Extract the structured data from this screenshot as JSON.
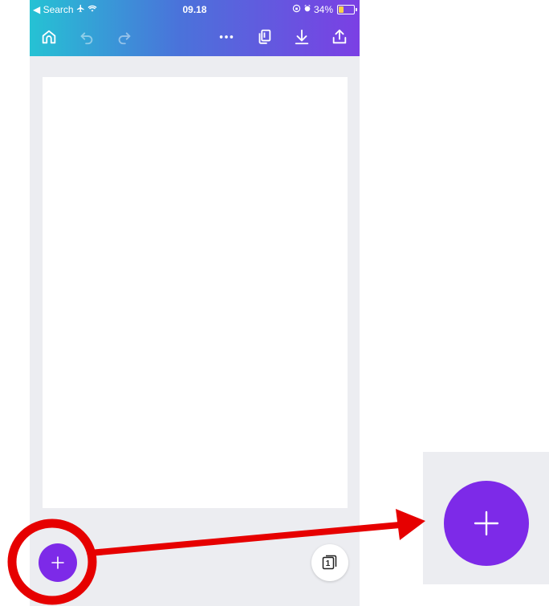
{
  "status_bar": {
    "back_label": "◀ Search",
    "time": "09.18",
    "battery": "34%",
    "battery_level": 0.34
  },
  "toolbar": {
    "icons": [
      "home-icon",
      "undo-icon",
      "redo-icon",
      "more-icon",
      "duplicate-page-icon",
      "download-icon",
      "share-icon"
    ]
  },
  "bottom": {
    "page_count": "1",
    "add_icon": "plus-icon"
  },
  "colors": {
    "accent": "#7d2ae8",
    "gradient_start": "#25c2d4",
    "gradient_end": "#7b3fe4",
    "annotation": "#e60000",
    "background": "#ecedf1"
  }
}
